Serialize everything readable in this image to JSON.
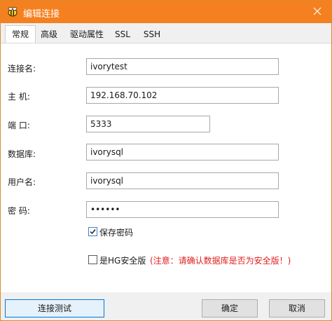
{
  "window": {
    "title": "编辑连接",
    "accent_color": "#f5801f",
    "icons": {
      "app": "bee-logo-icon",
      "close": "close-icon"
    }
  },
  "tabs": [
    {
      "label": "常规",
      "active": true
    },
    {
      "label": "高级",
      "active": false
    },
    {
      "label": "驱动属性",
      "active": false
    },
    {
      "label": "SSL",
      "active": false
    },
    {
      "label": "SSH",
      "active": false
    }
  ],
  "form": {
    "connection_name": {
      "label": "连接名:",
      "value": "ivorytest"
    },
    "host": {
      "label": "主  机:",
      "value": "192.168.70.102"
    },
    "port": {
      "label": "端  口:",
      "value": "5333"
    },
    "database": {
      "label": "数据库:",
      "value": "ivorysql"
    },
    "username": {
      "label": "用户名:",
      "value": "ivorysql"
    },
    "password": {
      "label": "密  码:",
      "masked_value": "••••••"
    },
    "save_password": {
      "label": "保存密码",
      "checked": true
    },
    "hg_secure": {
      "label": "是HG安全版",
      "checked": false,
      "warning": "(注意：请确认数据库是否为安全版！)",
      "warning_color": "#e02020"
    }
  },
  "buttons": {
    "test": "连接测试",
    "ok": "确定",
    "cancel": "取消"
  }
}
